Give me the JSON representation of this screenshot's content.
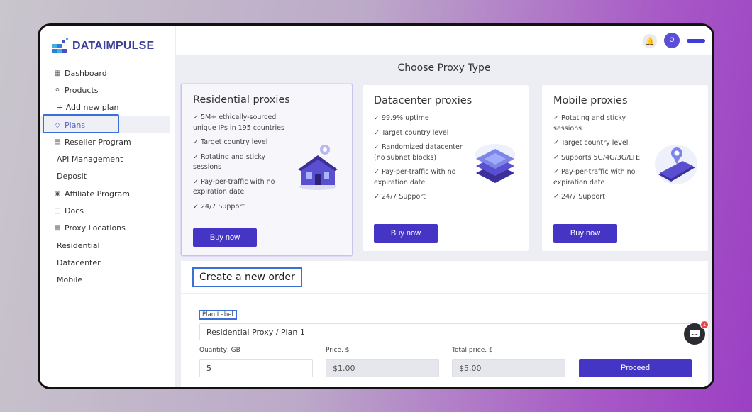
{
  "brand": {
    "name": "DATAIMPULSE"
  },
  "header": {
    "avatar_letter": "O"
  },
  "sidebar": {
    "items": [
      {
        "label": "Dashboard",
        "icon": "grid-icon"
      },
      {
        "label": "Products",
        "icon": "globe-icon"
      },
      {
        "label": "+ Add new plan",
        "icon": ""
      },
      {
        "label": "Plans",
        "icon": "tag-icon"
      },
      {
        "label": "Reseller Program",
        "icon": "book-icon"
      },
      {
        "label": "API Management",
        "icon": ""
      },
      {
        "label": "Deposit",
        "icon": ""
      },
      {
        "label": "Affiliate Program",
        "icon": "eye-icon"
      },
      {
        "label": "Docs",
        "icon": "folder-icon"
      },
      {
        "label": "Proxy Locations",
        "icon": "book-icon"
      },
      {
        "label": "Residential",
        "icon": ""
      },
      {
        "label": "Datacenter",
        "icon": ""
      },
      {
        "label": "Mobile",
        "icon": ""
      }
    ]
  },
  "main": {
    "title": "Choose Proxy Type",
    "cards": [
      {
        "title": "Residential proxies",
        "features": [
          "5M+ ethically-sourced unique IPs in 195 countries",
          "Target country level",
          "Rotating and sticky sessions",
          "Pay-per-traffic with no expiration date",
          "24/7 Support"
        ],
        "button": "Buy now"
      },
      {
        "title": "Datacenter proxies",
        "features": [
          "99.9% uptime",
          "Target country level",
          "Randomized datacenter (no subnet blocks)",
          "Pay-per-traffic with no expiration date",
          "24/7 Support"
        ],
        "button": "Buy now"
      },
      {
        "title": "Mobile proxies",
        "features": [
          "Rotating and sticky sessions",
          "Target country level",
          "Supports 5G/4G/3G/LTE",
          "Pay-per-traffic with no expiration date",
          "24/7 Support"
        ],
        "button": "Buy now"
      }
    ],
    "order": {
      "title": "Create a new order",
      "plan_label": "Plan Label",
      "plan_value": "Residential Proxy / Plan 1",
      "quantity_label": "Quantity, GB",
      "quantity_value": "5",
      "price_label": "Price, $",
      "price_value": "$1.00",
      "total_label": "Total price, $",
      "total_value": "$5.00",
      "proceed": "Proceed"
    },
    "chat_badge": "1"
  },
  "colors": {
    "accent": "#4435c4",
    "brand": "#3b3f9a",
    "highlight": "#3a6fd8"
  }
}
